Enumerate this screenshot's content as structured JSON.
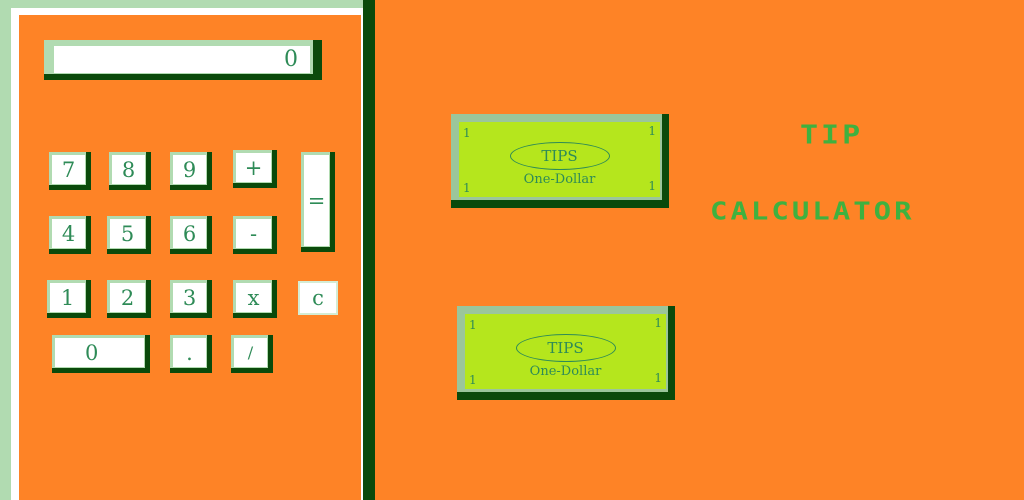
{
  "display": {
    "value": "0"
  },
  "keys": {
    "k7": "7",
    "k8": "8",
    "k9": "9",
    "plus": "+",
    "k4": "4",
    "k5": "5",
    "k6": "6",
    "minus": "-",
    "k1": "1",
    "k2": "2",
    "k3": "3",
    "times": "x",
    "clear": "c",
    "k0": "0",
    "dot": ".",
    "divide": "/",
    "equals": "="
  },
  "tips": [
    {
      "oval_label": "TIPS",
      "denomination": "One-Dollar",
      "corner": "1"
    },
    {
      "oval_label": "TIPS",
      "denomination": "One-Dollar",
      "corner": "1"
    }
  ],
  "title": {
    "line1": "TIP",
    "line2": "CALCULATOR"
  },
  "colors": {
    "background": "#fe8326",
    "key_face": "#ffffff",
    "key_shadow": "#0b4a0b",
    "key_highlight": "#b1dbb1",
    "bill": "#b5e61d",
    "text_green": "#2e8b57",
    "title_green": "#3fb13f"
  }
}
